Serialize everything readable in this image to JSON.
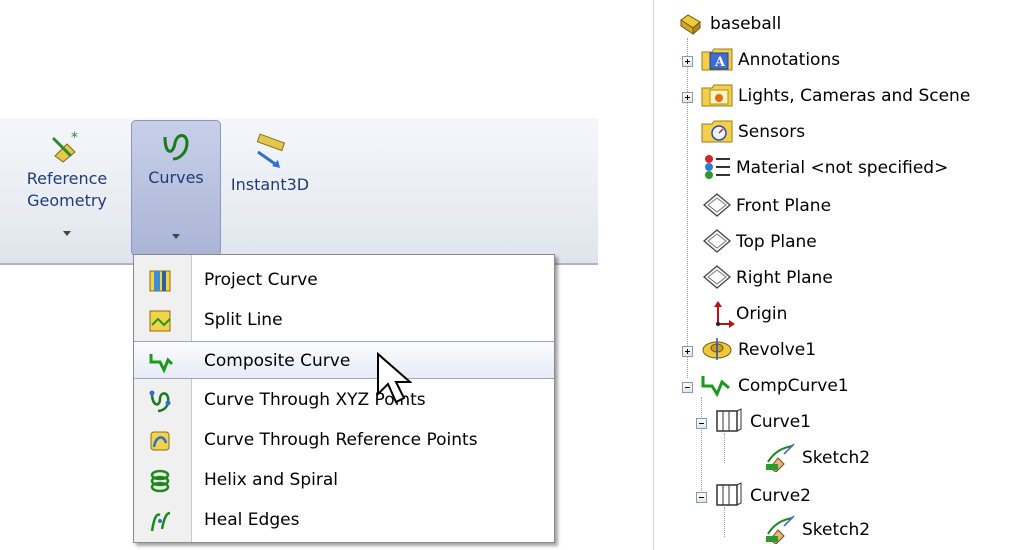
{
  "toolbar": {
    "reference_geometry_label": "Reference Geometry",
    "curves_label": "Curves",
    "instant3d_label": "Instant3D"
  },
  "menu": {
    "items": [
      {
        "label": "Project Curve",
        "icon": "project-curve-icon"
      },
      {
        "label": "Split Line",
        "icon": "split-line-icon"
      },
      {
        "label": "Composite Curve",
        "icon": "composite-curve-icon"
      },
      {
        "label": "Curve Through XYZ Points",
        "icon": "curve-xyz-icon"
      },
      {
        "label": "Curve Through Reference Points",
        "icon": "curve-ref-points-icon"
      },
      {
        "label": "Helix and Spiral",
        "icon": "helix-icon"
      },
      {
        "label": "Heal Edges",
        "icon": "heal-edges-icon"
      }
    ],
    "highlighted": "Composite Curve"
  },
  "tree": {
    "root": "baseball",
    "nodes": [
      {
        "label": "Annotations",
        "icon": "annotations-icon"
      },
      {
        "label": "Lights, Cameras and Scene",
        "icon": "lights-icon"
      },
      {
        "label": "Sensors",
        "icon": "sensors-icon"
      },
      {
        "label": "Material <not specified>",
        "icon": "material-icon"
      },
      {
        "label": "Front Plane",
        "icon": "plane-icon"
      },
      {
        "label": "Top Plane",
        "icon": "plane-icon"
      },
      {
        "label": "Right Plane",
        "icon": "plane-icon"
      },
      {
        "label": "Origin",
        "icon": "origin-icon"
      },
      {
        "label": "Revolve1",
        "icon": "revolve-icon"
      },
      {
        "label": "CompCurve1",
        "icon": "composite-curve-icon"
      },
      {
        "label": "Curve1",
        "icon": "curve-icon"
      },
      {
        "label": "Sketch2",
        "icon": "sketch-icon"
      },
      {
        "label": "Curve2",
        "icon": "curve-icon"
      },
      {
        "label": "Sketch2",
        "icon": "sketch-icon"
      }
    ]
  },
  "colors": {
    "toolbar_text": "#1f3b78",
    "selected_button": "#aab4d6",
    "menu_highlight_border": "#9aa6c4"
  }
}
